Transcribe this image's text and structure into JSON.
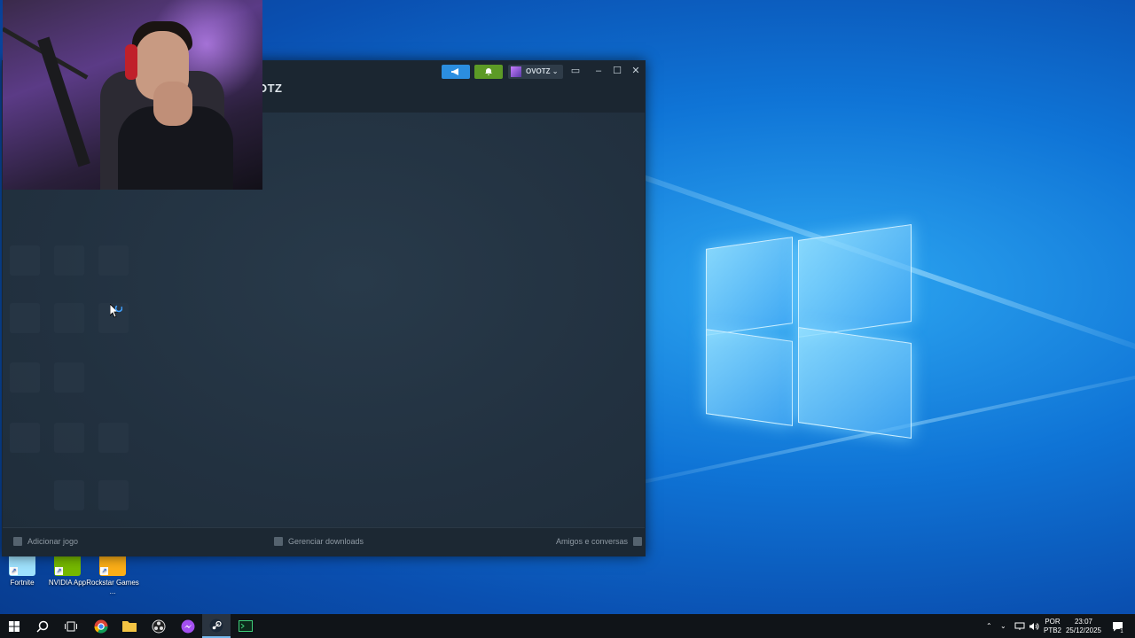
{
  "desktop": {
    "icons": [
      {
        "label": "Fortnite",
        "color": "#9fe3ff"
      },
      {
        "label": "NVIDIA App",
        "color": "#76b900"
      },
      {
        "label": "Rockstar Games ...",
        "color": "#fcaf17"
      }
    ]
  },
  "webcam": {
    "description": "streamer webcam overlay"
  },
  "steam": {
    "title_partial": "OTZ",
    "account_name": "OVOTZ",
    "footer": {
      "add_game": "Adicionar jogo",
      "manage_downloads": "Gerenciar downloads",
      "friends_chat": "Amigos e conversas"
    },
    "colors": {
      "announce": "#2b8ee0",
      "notify": "#5c9a26"
    }
  },
  "taskbar": {
    "language": "POR",
    "keyboard": "PTB2",
    "time": "23:07",
    "date": "25/12/2025",
    "notification_count": "1"
  }
}
